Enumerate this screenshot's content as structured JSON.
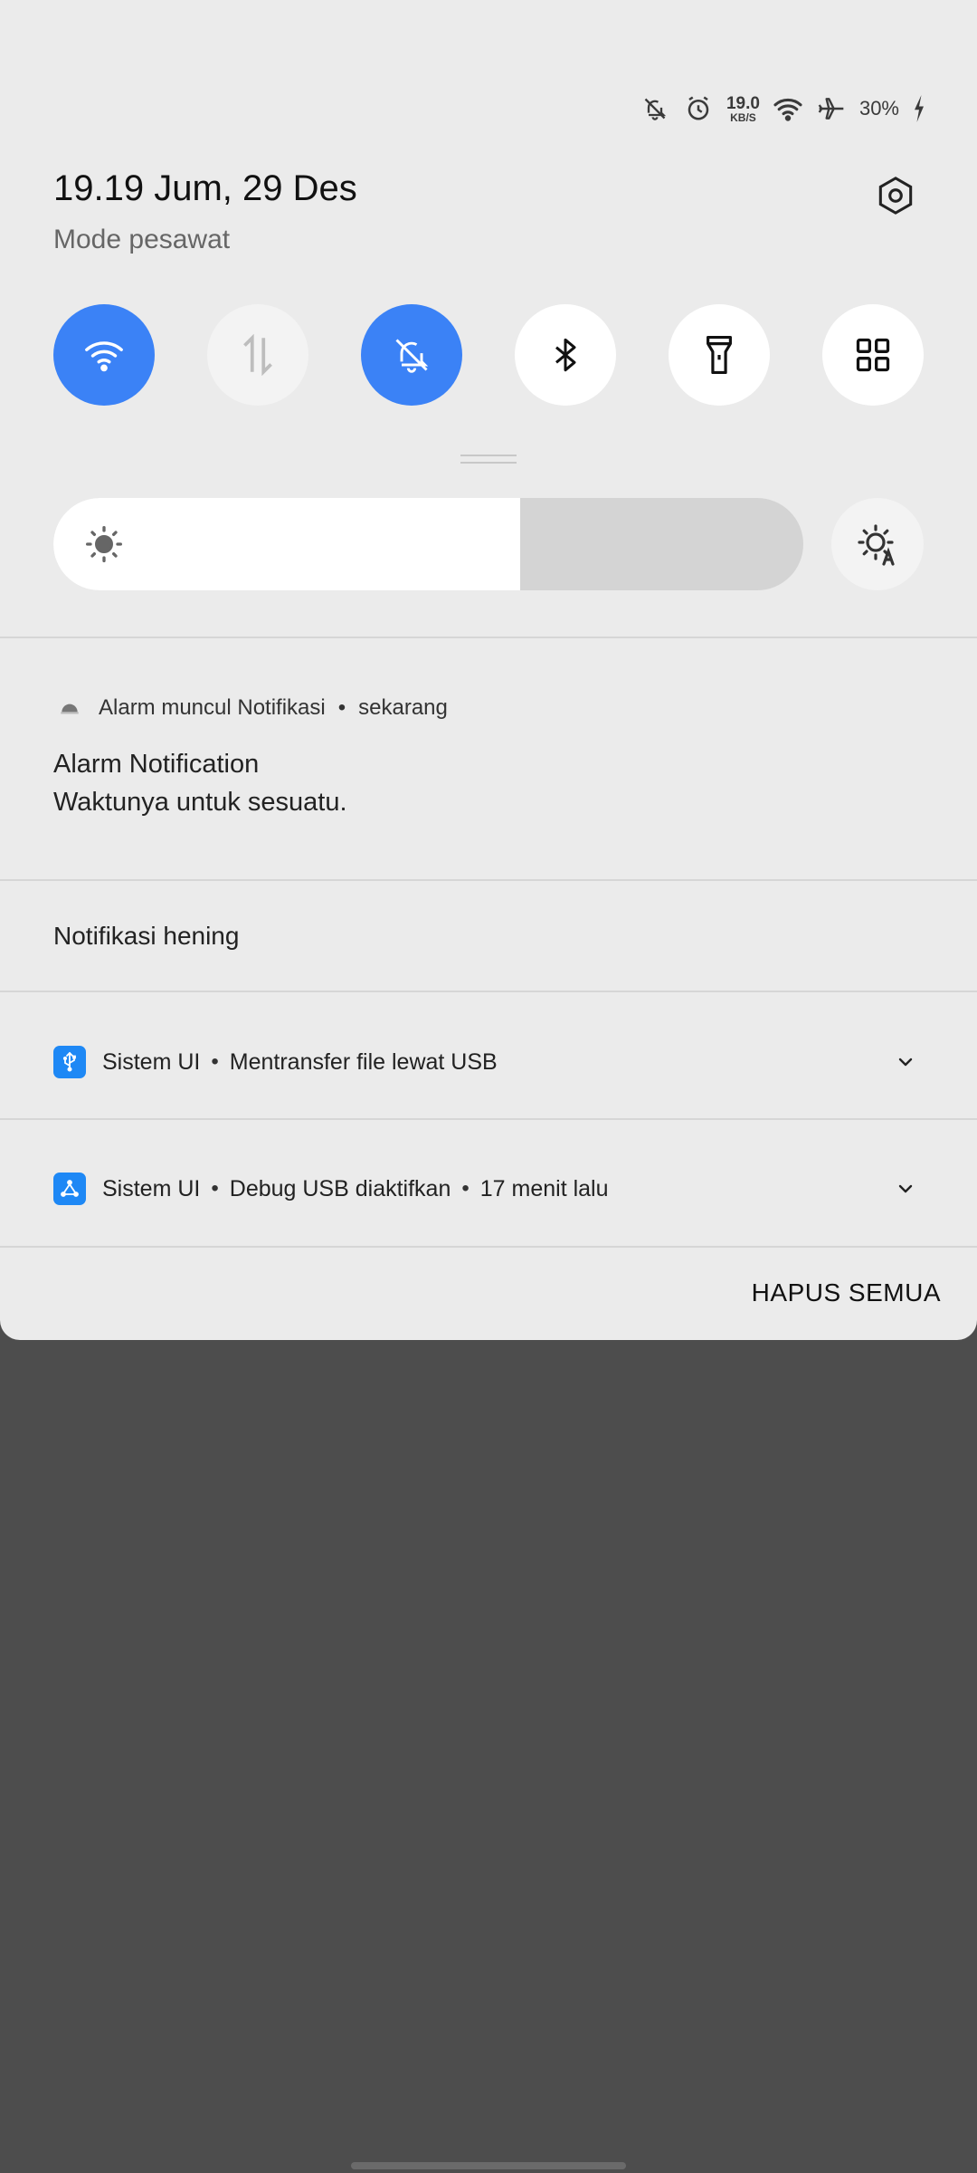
{
  "status_bar": {
    "icons": [
      "bell-muted-icon",
      "alarm-clock-icon",
      "wifi-icon",
      "airplane-icon",
      "charging-icon"
    ],
    "net_speed_value": "19.0",
    "net_speed_unit": "KB/S",
    "battery": "30%"
  },
  "header": {
    "datetime": "19.19  Jum, 29 Des",
    "mode": "Mode pesawat"
  },
  "quick_toggles": [
    {
      "name": "wifi",
      "state": "on"
    },
    {
      "name": "mobile-data",
      "state": "off"
    },
    {
      "name": "do-not-disturb",
      "state": "on"
    },
    {
      "name": "bluetooth",
      "state": "off"
    },
    {
      "name": "flashlight",
      "state": "off"
    },
    {
      "name": "more-apps",
      "state": "off"
    }
  ],
  "brightness": {
    "level": 0.623
  },
  "colors": {
    "accent": "#3b82f6",
    "shade_bg": "#ebebeb",
    "backdrop": "#4d4d4d"
  },
  "notification": {
    "app": "Alarm muncul Notifikasi",
    "time": "sekarang",
    "title": "Alarm Notification",
    "text": "Waktunya untuk sesuatu."
  },
  "silent_section": {
    "label": "Notifikasi hening"
  },
  "silent_items": [
    {
      "app": "Sistem UI",
      "text": "Mentransfer file lewat USB",
      "icon": "usb-icon"
    },
    {
      "app": "Sistem UI",
      "text": "Debug USB diaktifkan",
      "time": "17 menit lalu",
      "icon": "debug-icon"
    }
  ],
  "clear_all_label": "HAPUS SEMUA"
}
